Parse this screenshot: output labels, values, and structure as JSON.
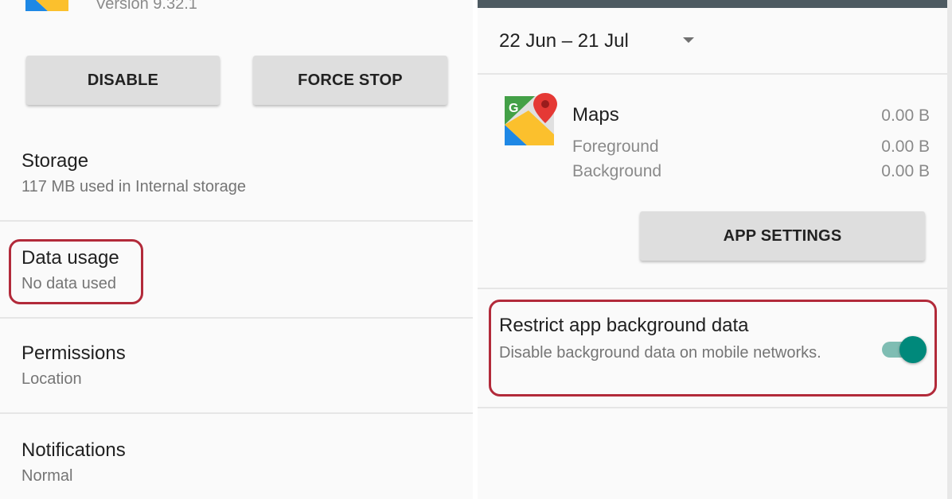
{
  "left": {
    "app_version": "Version 9.32.1",
    "disable_label": "DISABLE",
    "force_stop_label": "FORCE STOP",
    "storage": {
      "title": "Storage",
      "subtitle": "117 MB used in Internal storage"
    },
    "data_usage": {
      "title": "Data usage",
      "subtitle": "No data used",
      "highlighted": true
    },
    "permissions": {
      "title": "Permissions",
      "subtitle": "Location"
    },
    "notifications": {
      "title": "Notifications",
      "subtitle": "Normal"
    }
  },
  "right": {
    "date_range": "22 Jun – 21 Jul",
    "app": {
      "name": "Maps",
      "total": "0.00 B",
      "foreground_label": "Foreground",
      "foreground_value": "0.00 B",
      "background_label": "Background",
      "background_value": "0.00 B"
    },
    "app_settings_label": "APP SETTINGS",
    "restrict": {
      "title": "Restrict app background data",
      "subtitle": "Disable background data on mobile networks.",
      "toggle_on": true,
      "highlighted": true
    }
  },
  "colors": {
    "highlight": "#b22a3a",
    "toggle_accent": "#00897b",
    "topbar": "#4d5a61"
  },
  "icons": [
    "maps-icon",
    "dropdown-caret-icon",
    "toggle-switch"
  ]
}
